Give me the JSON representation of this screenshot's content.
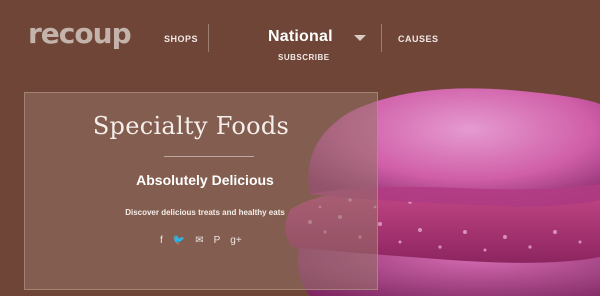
{
  "brand": {
    "logo": "recoup"
  },
  "nav": {
    "shops": "SHOPS",
    "region": "National",
    "subscribe": "SUBSCRIBE",
    "causes": "CAUSES"
  },
  "hero": {
    "title": "Specialty Foods",
    "subtitle": "Absolutely Delicious",
    "tagline": "Discover delicious treats and healthy eats"
  },
  "social": {
    "icons": [
      "facebook-icon",
      "twitter-icon",
      "email-icon",
      "pinterest-icon",
      "google-plus-icon"
    ],
    "glyphs": [
      "f",
      "🐦",
      "✉",
      "P",
      "g+"
    ]
  },
  "colors": {
    "background": "#6e4537",
    "panel": "#967366",
    "macaron": "#d15ca5",
    "filling": "#b83a7a",
    "text": "#ffffff"
  }
}
